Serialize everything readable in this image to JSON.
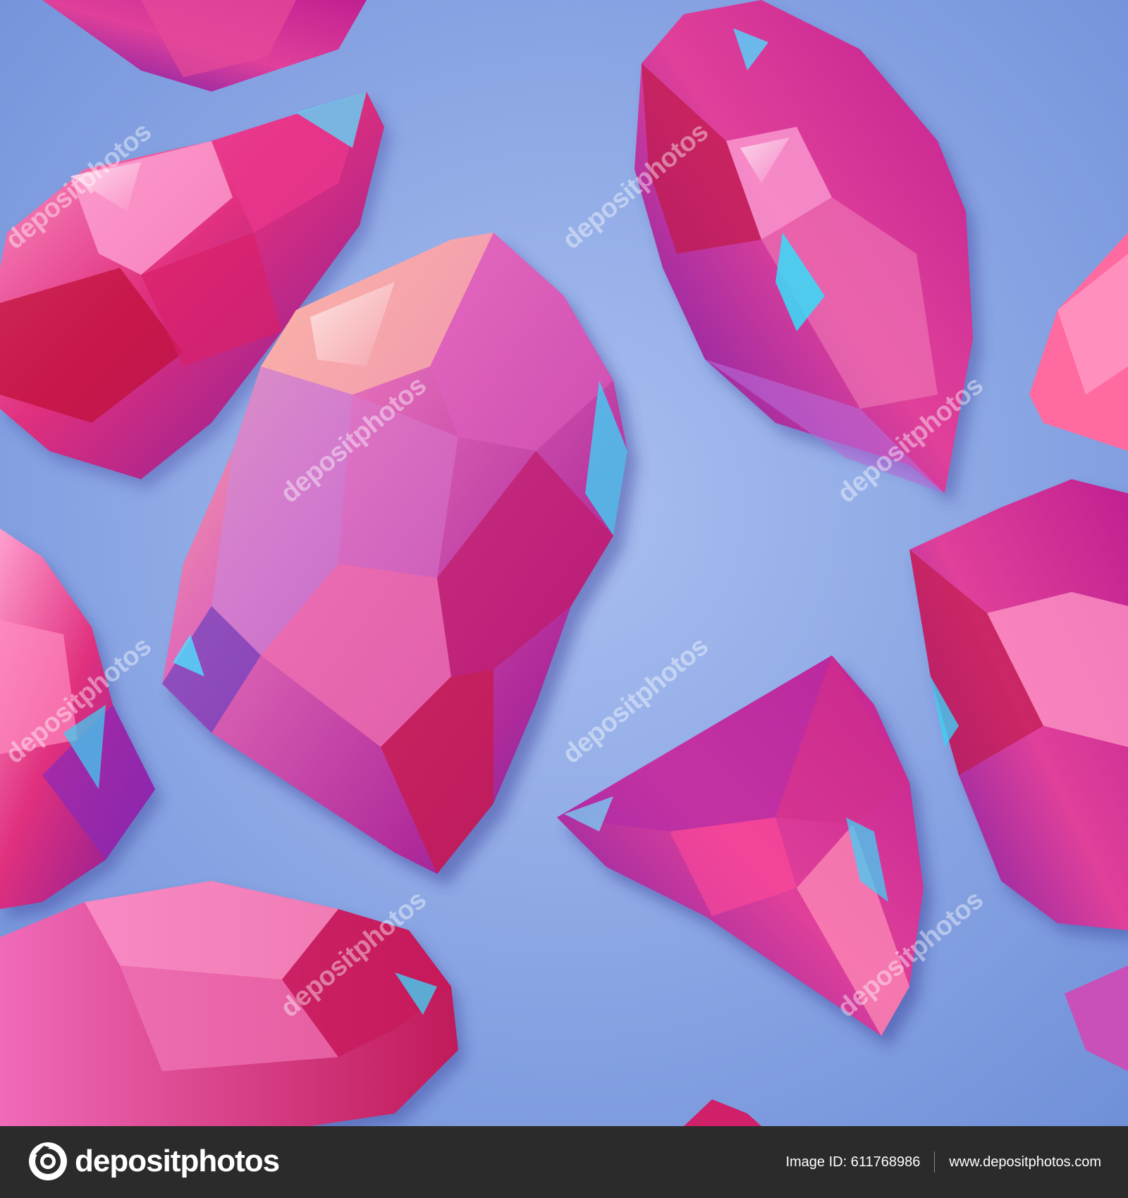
{
  "watermark_text": "depositphotos",
  "footer": {
    "logo_text": "depositphotos",
    "image_id": "Image ID: 611768986",
    "site_url": "www.depositphotos.com"
  },
  "colors": {
    "background": "#7fa0e0",
    "footer_background": "#2b2b2b",
    "gem_magenta": "#d4207a",
    "gem_pink": "#f06aa8",
    "gem_purple": "#8a2bb8",
    "highlight_cyan": "#3fd0f0"
  }
}
